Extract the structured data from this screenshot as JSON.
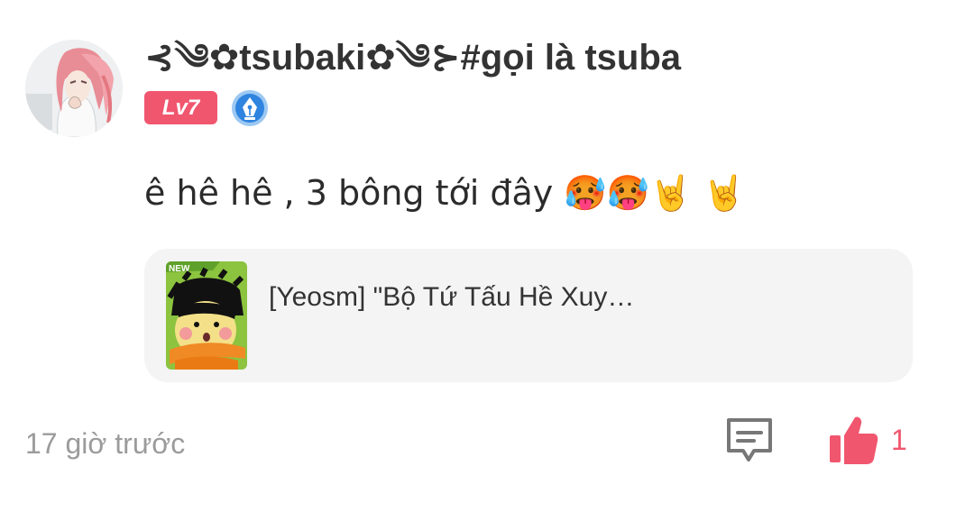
{
  "comment": {
    "username": "⊰༄✿tsubaki✿༄⊱#gọi là tsuba",
    "level_badge": "Lv7",
    "text": "ê hê hê , 3 bông tới đây 🥵🥵🤘 🤘",
    "timestamp": "17 giờ trước",
    "like_count": "1"
  },
  "linked_post": {
    "new_tag": "NEW",
    "title": "[Yeosm] \"Bộ Tứ Tấu Hề Xuy…"
  },
  "colors": {
    "accent": "#f1566f",
    "card_background": "#f4f4f4",
    "muted_text": "#9b9b9b",
    "badge_blue": "#2f84e0"
  },
  "icons": {
    "avatar": "anime-girl-avatar",
    "badge": "fountain-pen-badge-icon",
    "reply": "comment-bubble-icon",
    "like": "thumbs-up-icon"
  }
}
